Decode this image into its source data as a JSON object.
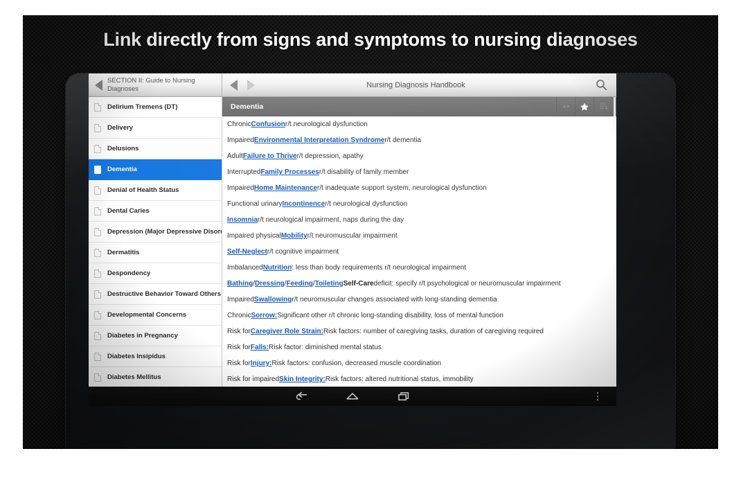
{
  "headline": "Link directly from signs and symptoms to nursing diagnoses",
  "toolbar": {
    "section_title": "SECTION II: Guide to Nursing Diagnoses",
    "back_icon": "triangle-left-icon",
    "nav_prev_icon": "triangle-left-icon",
    "nav_next_icon": "triangle-right-icon",
    "document_title": "Nursing Diagnosis Handbook",
    "search_icon": "search-icon"
  },
  "content_header": {
    "title": "Dementia",
    "actions": [
      {
        "name": "link-icon",
        "label": "Link",
        "active": false
      },
      {
        "name": "star-icon",
        "label": "Bookmark",
        "active": true
      },
      {
        "name": "list-icon",
        "label": "Outline",
        "active": false
      }
    ]
  },
  "sidebar": {
    "items": [
      {
        "label": "Delirium Tremens (DT)",
        "selected": false
      },
      {
        "label": "Delivery",
        "selected": false
      },
      {
        "label": "Delusions",
        "selected": false
      },
      {
        "label": "Dementia",
        "selected": true
      },
      {
        "label": "Denial of Health Status",
        "selected": false
      },
      {
        "label": "Dental Caries",
        "selected": false
      },
      {
        "label": "Depression (Major Depressive Disorder)",
        "selected": false
      },
      {
        "label": "Dermatitis",
        "selected": false
      },
      {
        "label": "Despondency",
        "selected": false
      },
      {
        "label": "Destructive Behavior Toward Others",
        "selected": false
      },
      {
        "label": "Developmental Concerns",
        "selected": false
      },
      {
        "label": "Diabetes in Pregnancy",
        "selected": false
      },
      {
        "label": "Diabetes Insipidus",
        "selected": false
      },
      {
        "label": "Diabetes Mellitus",
        "selected": false
      }
    ]
  },
  "content": {
    "rows": [
      [
        {
          "t": "Chronic ",
          "s": "plain"
        },
        {
          "t": "Confusion",
          "s": "link"
        },
        {
          "t": " r/t neurological dysfunction",
          "s": "plain"
        }
      ],
      [
        {
          "t": "Impaired ",
          "s": "plain"
        },
        {
          "t": "Environmental Interpretation Syndrome",
          "s": "link"
        },
        {
          "t": " r/t dementia",
          "s": "plain"
        }
      ],
      [
        {
          "t": "Adult ",
          "s": "plain"
        },
        {
          "t": "Failure to Thrive",
          "s": "link"
        },
        {
          "t": " r/t depression, apathy",
          "s": "plain"
        }
      ],
      [
        {
          "t": "Interrupted ",
          "s": "plain"
        },
        {
          "t": "Family Processes",
          "s": "link"
        },
        {
          "t": " r/t disability of family member",
          "s": "plain"
        }
      ],
      [
        {
          "t": "Impaired ",
          "s": "plain"
        },
        {
          "t": "Home Maintenance",
          "s": "link"
        },
        {
          "t": " r/t inadequate support system, neurological dysfunction",
          "s": "plain"
        }
      ],
      [
        {
          "t": "Functional urinary ",
          "s": "plain"
        },
        {
          "t": "Incontinence",
          "s": "link"
        },
        {
          "t": " r/t neurological dysfunction",
          "s": "plain"
        }
      ],
      [
        {
          "t": "Insomnia",
          "s": "link"
        },
        {
          "t": " r/t neurological impairment, naps during the day",
          "s": "plain"
        }
      ],
      [
        {
          "t": "Impaired physical ",
          "s": "plain"
        },
        {
          "t": "Mobility",
          "s": "link"
        },
        {
          "t": " r/t neuromuscular impairment",
          "s": "plain"
        }
      ],
      [
        {
          "t": "Self-Neglect",
          "s": "link"
        },
        {
          "t": " r/t cognitive impairment",
          "s": "plain"
        }
      ],
      [
        {
          "t": "Imbalanced ",
          "s": "plain"
        },
        {
          "t": "Nutrition",
          "s": "link"
        },
        {
          "t": ": less than body requirements r/t neurological impairment",
          "s": "plain"
        }
      ],
      [
        {
          "t": "Bathing",
          "s": "link"
        },
        {
          "t": "/",
          "s": "plain"
        },
        {
          "t": "Dressing",
          "s": "link"
        },
        {
          "t": "/",
          "s": "plain"
        },
        {
          "t": "Feeding",
          "s": "link"
        },
        {
          "t": "/",
          "s": "plain"
        },
        {
          "t": "Toileting",
          "s": "link"
        },
        {
          "t": "Self-Care",
          "s": "bold"
        },
        {
          "t": " deficit: specify r/t psychological or neuromuscular impairment",
          "s": "plain"
        }
      ],
      [
        {
          "t": "Impaired ",
          "s": "plain"
        },
        {
          "t": "Swallowing",
          "s": "link"
        },
        {
          "t": " r/t neuromuscular changes associated with long-standing dementia",
          "s": "plain"
        }
      ],
      [
        {
          "t": "Chronic ",
          "s": "plain"
        },
        {
          "t": "Sorrow:",
          "s": "link"
        },
        {
          "t": " Significant other r/t chronic long-standing disability, loss of mental function",
          "s": "plain"
        }
      ],
      [
        {
          "t": "Risk for ",
          "s": "plain"
        },
        {
          "t": "Caregiver Role Strain:",
          "s": "link"
        },
        {
          "t": " Risk factors: number of caregiving tasks, duration of caregiving required",
          "s": "plain"
        }
      ],
      [
        {
          "t": "Risk for ",
          "s": "plain"
        },
        {
          "t": "Falls:",
          "s": "link"
        },
        {
          "t": " Risk factor: diminished mental status",
          "s": "plain"
        }
      ],
      [
        {
          "t": "Risk for ",
          "s": "plain"
        },
        {
          "t": "Injury:",
          "s": "link"
        },
        {
          "t": " Risk factors: confusion, decreased muscle coordination",
          "s": "plain"
        }
      ],
      [
        {
          "t": "Risk for impaired ",
          "s": "plain"
        },
        {
          "t": "Skin Integrity:",
          "s": "link"
        },
        {
          "t": " Risk factors: altered nutritional status, immobility",
          "s": "plain"
        }
      ]
    ]
  },
  "navbar": {
    "buttons": [
      {
        "name": "back-icon",
        "label": "Back"
      },
      {
        "name": "home-icon",
        "label": "Home"
      },
      {
        "name": "recents-icon",
        "label": "Recent apps"
      }
    ],
    "overflow_icon": "overflow-menu-icon"
  },
  "colors": {
    "selection_blue": "#1577e0",
    "link_blue": "#1459b8",
    "header_gray": "#757575",
    "panel_dark": "#0d0d0d"
  }
}
